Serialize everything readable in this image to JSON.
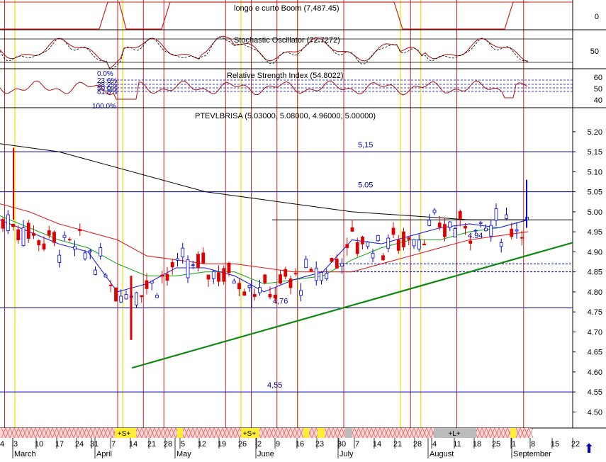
{
  "chart_data": {
    "type": "candlestick",
    "title": "PTEVLBRISA (5.03000, 5.08000, 4.96000, 5.00000)",
    "price_axis": {
      "ylim": [
        4.46,
        5.26
      ],
      "ticks": [
        "5.20",
        "5.15",
        "5.10",
        "5.05",
        "5.00",
        "4.95",
        "4.90",
        "4.85",
        "4.80",
        "4.75",
        "4.70",
        "4.65",
        "4.60",
        "4.55",
        "4.50"
      ]
    },
    "x_axis": {
      "day_labels": [
        "4",
        "3",
        "10",
        "17",
        "24",
        "31",
        "7",
        "14",
        "21",
        "28",
        "5",
        "12",
        "19",
        "26",
        "2",
        "9",
        "16",
        "23",
        "30",
        "7",
        "14",
        "21",
        "28",
        "4",
        "11",
        "18",
        "25",
        "1",
        "8",
        "15",
        "22"
      ],
      "month_labels": [
        "March",
        "April",
        "May",
        "June",
        "July",
        "August",
        "September"
      ]
    },
    "annotations": [
      {
        "text": "5,15",
        "price": 5.15
      },
      {
        "text": "5.05",
        "price": 5.05
      },
      {
        "text": "4,76",
        "price": 4.76
      },
      {
        "text": "4,55",
        "price": 4.55
      },
      {
        "text": "4.94",
        "price": 4.94
      }
    ],
    "horizontal_levels": [
      5.15,
      5.05,
      4.98,
      4.87,
      4.85,
      4.76,
      4.55
    ],
    "trendline": {
      "from": {
        "date": "2010-04-13",
        "price": 4.61
      },
      "to": {
        "date": "2010-09-13",
        "price": 4.92
      }
    },
    "series": [
      {
        "name": "",
        "color": "#000000",
        "values": [
          5.17,
          5.16,
          5.15,
          5.13,
          5.11,
          5.09,
          5.07,
          5.05,
          5.04,
          5.03,
          5.02,
          5.01,
          5.0,
          4.995,
          4.99,
          4.985,
          4.98,
          4.98,
          4.98
        ]
      },
      {
        "name": "",
        "color": "#dd2222",
        "values": [
          5.02,
          5.0,
          4.97,
          4.95,
          4.93,
          4.89,
          4.88,
          4.87,
          4.87,
          4.86,
          4.85,
          4.85,
          4.85,
          4.87,
          4.89,
          4.91,
          4.93,
          4.94,
          4.95
        ]
      },
      {
        "name": "",
        "color": "#22aa22",
        "values": [
          4.99,
          4.96,
          4.93,
          4.91,
          4.87,
          4.84,
          4.84,
          4.85,
          4.85,
          4.82,
          4.83,
          4.84,
          4.88,
          4.91,
          4.93,
          4.93,
          4.95,
          4.96,
          4.98
        ]
      },
      {
        "name": "",
        "color": "#2222dd",
        "values": [
          4.98,
          4.95,
          4.92,
          4.9,
          4.8,
          4.82,
          4.86,
          4.86,
          4.84,
          4.8,
          4.83,
          4.85,
          4.93,
          4.92,
          4.94,
          4.96,
          4.97,
          4.96,
          4.98
        ]
      }
    ]
  },
  "panels": {
    "top": {
      "title": "longo e curto Boom (7,487.45)",
      "tick": "0"
    },
    "stochastic": {
      "title": "Stochastic Oscillator (72.7272)",
      "tick": "50"
    },
    "rsi": {
      "title": "Relative Strength Index (54.8022)",
      "ticks": [
        "60",
        "50",
        "40"
      ],
      "fib": [
        "0.0%",
        "23.6%",
        "38.2%",
        "50.0%",
        "61.8%",
        "100.0%"
      ]
    }
  },
  "timeline_markers": [
    "+S+",
    "+S+",
    "+L+"
  ],
  "colors": {
    "up": "#0000dd",
    "down": "#dd0000",
    "grid": "#0000aa",
    "trend": "#118811",
    "event_red": "#cc2222",
    "event_yellow": "#eedd00"
  }
}
